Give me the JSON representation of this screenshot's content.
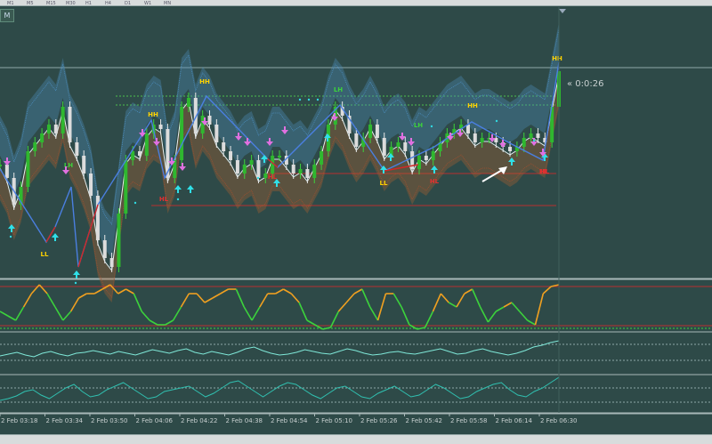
{
  "toolbar": {
    "timeframes": [
      "M1",
      "M5",
      "M15",
      "M30",
      "H1",
      "H4",
      "D1",
      "W1",
      "MN"
    ]
  },
  "window_tab": {
    "label": "M"
  },
  "countdown": {
    "label": "« 0:0:26"
  },
  "markers": [
    {
      "label": "LL",
      "color": "#ffd200",
      "type": "label"
    },
    {
      "label": "LH",
      "color": "#3cd23c",
      "type": "label"
    },
    {
      "label": "HH",
      "color": "#ffd200",
      "type": "label"
    },
    {
      "label": "HL",
      "color": "#e23030",
      "type": "label"
    },
    {
      "label": "HH",
      "color": "#ffd200",
      "type": "label"
    },
    {
      "label": "HL",
      "color": "#e23030",
      "type": "label"
    },
    {
      "label": "HL",
      "color": "#e23030",
      "type": "label"
    },
    {
      "label": "LH",
      "color": "#3cd23c",
      "type": "label"
    },
    {
      "label": "LL",
      "color": "#ffd200",
      "type": "label"
    },
    {
      "label": "HL",
      "color": "#e23030",
      "type": "label"
    },
    {
      "label": "LH",
      "color": "#3cd23c",
      "type": "label"
    },
    {
      "label": "HH",
      "color": "#ffd200",
      "type": "label"
    },
    {
      "label": "HL",
      "color": "#e23030",
      "type": "label"
    },
    {
      "label": "HH",
      "color": "#ffd200",
      "type": "label"
    }
  ],
  "chart_data": {
    "type": "line",
    "x": [
      "2 Feb 03:18",
      "2 Feb 03:34",
      "2 Feb 03:50",
      "2 Feb 04:06",
      "2 Feb 04:22",
      "2 Feb 04:38",
      "2 Feb 04:54",
      "2 Feb 05:10",
      "2 Feb 05:26",
      "2 Feb 05:42",
      "2 Feb 05:58",
      "2 Feb 06:14",
      "2 Feb 06:30"
    ],
    "xlabels": [
      "2 Feb 03:18",
      "2 Feb 03:34",
      "2 Feb 03:50",
      "2 Feb 04:06",
      "2 Feb 04:22",
      "2 Feb 04:38",
      "2 Feb 04:54",
      "2 Feb 05:10",
      "2 Feb 05:26",
      "2 Feb 05:42",
      "2 Feb 05:58",
      "2 Feb 06:14",
      "2 Feb 06:30"
    ],
    "price": [
      185,
      200,
      230,
      210,
      170,
      160,
      150,
      140,
      150,
      120,
      160,
      175,
      195,
      220,
      270,
      290,
      300,
      240,
      180,
      170,
      175,
      150,
      140,
      145,
      200,
      180,
      120,
      110,
      150,
      130,
      140,
      160,
      170,
      180,
      195,
      185,
      180,
      200,
      195,
      175,
      175,
      185,
      195,
      190,
      200,
      185,
      170,
      140,
      120,
      130,
      150,
      165,
      155,
      140,
      155,
      175,
      165,
      160,
      170,
      190,
      175,
      180,
      170,
      160,
      150,
      145,
      140,
      150,
      160,
      155,
      155,
      160,
      165,
      170,
      165,
      155,
      150,
      155,
      160,
      120,
      80
    ],
    "oscillator": [
      {
        "name": "osc",
        "values": [
          350,
          355,
          360,
          345,
          330,
          320,
          330,
          345,
          360,
          350,
          335,
          330,
          330,
          325,
          320,
          330,
          325,
          330,
          350,
          360,
          365,
          365,
          360,
          345,
          330,
          330,
          340,
          335,
          330,
          325,
          325,
          345,
          360,
          345,
          330,
          330,
          325,
          330,
          340,
          360,
          365,
          370,
          368,
          350,
          340,
          330,
          325,
          345,
          360,
          330,
          330,
          345,
          365,
          370,
          368,
          350,
          330,
          340,
          345,
          330,
          325,
          345,
          362,
          350,
          345,
          340,
          350,
          360,
          365,
          330,
          322,
          320
        ]
      }
    ],
    "panel3": [
      {
        "name": "p3",
        "values": [
          400,
          398,
          396,
          399,
          401,
          397,
          395,
          398,
          400,
          397,
          396,
          394,
          396,
          398,
          395,
          397,
          399,
          396,
          393,
          395,
          397,
          394,
          392,
          396,
          398,
          395,
          397,
          399,
          396,
          392,
          390,
          394,
          397,
          399,
          398,
          396,
          393,
          395,
          397,
          398,
          395,
          392,
          394,
          397,
          399,
          398,
          396,
          395,
          397,
          398,
          396,
          394,
          392,
          395,
          398,
          397,
          394,
          392,
          395,
          397,
          399,
          397,
          394,
          390,
          388,
          385,
          383
        ]
      }
    ],
    "panel4": [
      {
        "name": "p4",
        "values": [
          450,
          448,
          445,
          440,
          438,
          444,
          448,
          442,
          436,
          432,
          440,
          446,
          444,
          438,
          434,
          430,
          436,
          442,
          448,
          446,
          440,
          438,
          436,
          434,
          440,
          446,
          442,
          436,
          430,
          428,
          434,
          440,
          446,
          440,
          434,
          430,
          432,
          438,
          444,
          448,
          442,
          436,
          434,
          440,
          446,
          448,
          442,
          438,
          434,
          440,
          446,
          444,
          438,
          432,
          436,
          442,
          448,
          446,
          440,
          436,
          432,
          430,
          438,
          444,
          446,
          440,
          436,
          430,
          424
        ]
      }
    ],
    "hlines": [
      76,
      108,
      118,
      195,
      231
    ],
    "annotation": "arrow pointing up-right near 2 Feb 06:00"
  }
}
